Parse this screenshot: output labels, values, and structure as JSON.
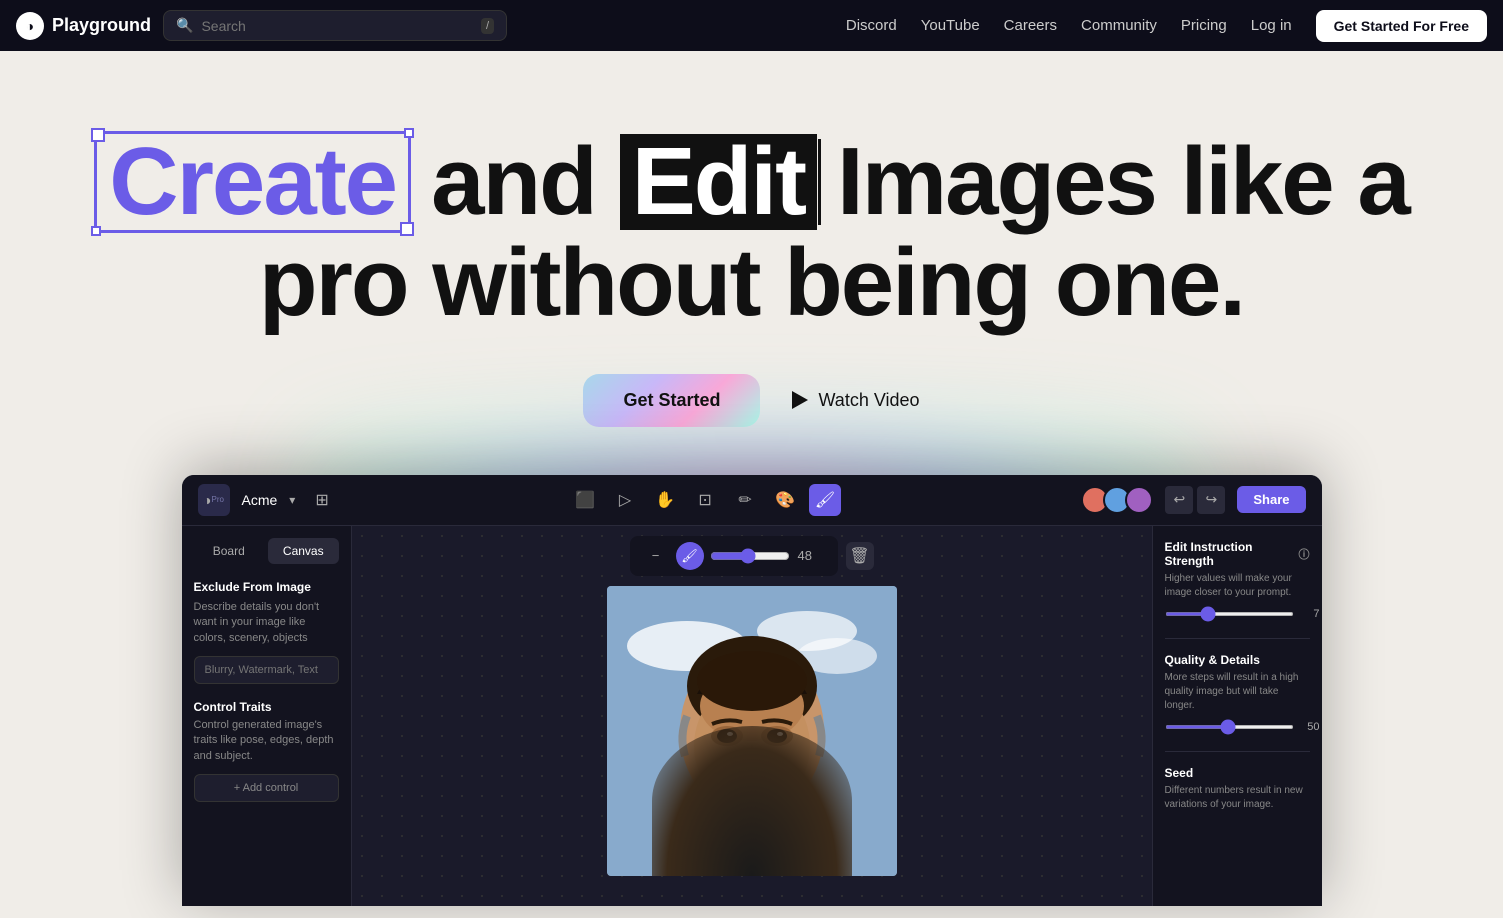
{
  "nav": {
    "brand": "Playground",
    "search_placeholder": "Search",
    "search_kbd": "/",
    "links": [
      {
        "label": "Discord",
        "name": "nav-discord"
      },
      {
        "label": "YouTube",
        "name": "nav-youtube"
      },
      {
        "label": "Careers",
        "name": "nav-careers"
      },
      {
        "label": "Community",
        "name": "nav-community"
      },
      {
        "label": "Pricing",
        "name": "nav-pricing"
      }
    ],
    "login_label": "Log in",
    "cta_label": "Get Started For Free"
  },
  "hero": {
    "headline_create": "Create",
    "headline_and": "and",
    "headline_edit": "Edit",
    "headline_rest": "Images like a",
    "headline_line2": "pro without being one.",
    "cta_label": "Get Started",
    "watch_label": "Watch Video"
  },
  "app": {
    "brand": "Acme",
    "toolbar_icons": [
      "⬜",
      "▷",
      "✋",
      "⊡",
      "✏",
      "🎨",
      "🖌"
    ],
    "active_tool_index": 6,
    "share_label": "Share",
    "tabs": [
      {
        "label": "Board"
      },
      {
        "label": "Canvas"
      }
    ],
    "active_tab": "Canvas",
    "left_panel": {
      "section1_title": "Exclude From Image",
      "section1_desc": "Describe details you don't want in your image like colors, scenery, objects",
      "section1_placeholder": "Blurry, Watermark, Text",
      "section2_title": "Control Traits",
      "section2_desc": "Control generated image's traits like pose, edges, depth and subject.",
      "add_control_label": "+ Add control"
    },
    "canvas_toolbar": {
      "brush_value": "48",
      "delete_icon": "🗑"
    },
    "right_panel": {
      "section1_title": "Edit Instruction Strength",
      "section1_desc": "Higher values will make your image closer to your prompt.",
      "section1_value": "7",
      "section2_title": "Quality & Details",
      "section2_desc": "More steps will result in a high quality image but will take longer.",
      "section2_value": "50",
      "section3_title": "Seed",
      "section3_desc": "Different numbers result in new variations of your image."
    }
  },
  "colors": {
    "accent": "#6b5ce7",
    "nav_bg": "#0d0d1a",
    "hero_bg": "#f0ede8"
  }
}
